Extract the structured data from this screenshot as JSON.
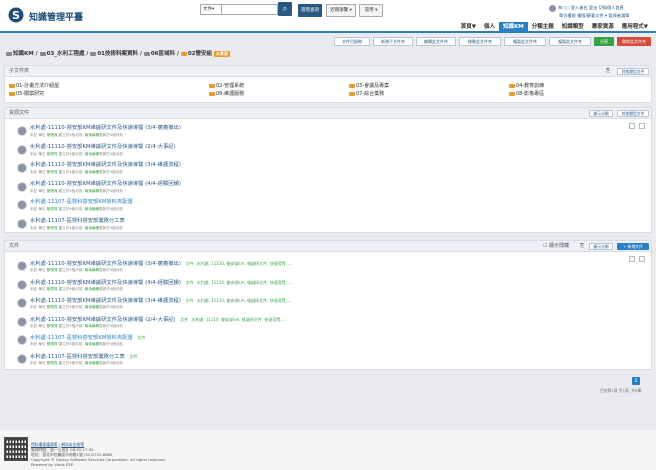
{
  "header": {
    "site_title": "知識管理平臺",
    "search_scope": "文件▾",
    "search_icon": "search-icon",
    "btn_advanced": "進階查詢",
    "btn_recent": "近期瀏覽 ▾",
    "btn_common": "常用 ▾",
    "user_line1": "林○○ 登入後台  登出  切換個人首頁",
    "user_line2": "單位權限  權限/觀看文件 ▾  管理者選單",
    "nav": [
      "首頁▼",
      "個人",
      "知識KM",
      "分類主題",
      "知識類型",
      "專家資源",
      "應用程式▼"
    ],
    "nav_active": 2
  },
  "toolbar": [
    "文件目錄樹",
    "新增子文件夾",
    "編輯此文件夾",
    "移動此文件夾",
    "複製此文件夾",
    "複製此文件夾",
    "",
    "刪除文件夾"
  ],
  "toolbar_green": "分享",
  "toolbar_red": "刪除此文件夾",
  "breadcrumb": [
    "知識KM",
    "03_水利工程處",
    "01技術科案資料",
    "06區域科",
    "02營安組"
  ],
  "breadcrumb_tag": "水資源",
  "subfolders": {
    "title": "子文件夾",
    "btn": "其他類型文件",
    "items": [
      "01-計畫方法介紹屋",
      "02-管理系統",
      "03-會議及專案",
      "04-教育訓練",
      "05-關案研究",
      "06-維護服務",
      "07-綜合業務",
      "08-影像專區"
    ]
  },
  "resources": {
    "title": "資源文件",
    "btn1": "顯示分類",
    "btn2": "其他類型文件",
    "items": [
      {
        "title": "水利處-11110-營安部KM維誠研文件及快速導覽 (3/4-廣義撤出)",
        "meta1": "未記 單位 ",
        "meta_g": "管理員",
        "meta2": " 建立於4個月前, ",
        "meta_g2": "最後編輯",
        "meta3": "更新於4個月前",
        "hl": false
      },
      {
        "title": "水利處-11110-營安部KM維誠研文件及快速導覽 (2/4-大事記)",
        "meta1": "未記 單位 ",
        "meta_g": "管理員",
        "meta2": " 建立於4個月前, ",
        "meta_g2": "最後編輯",
        "meta3": "更新於4個月前",
        "hl": false
      },
      {
        "title": "水利處-11110-營安部KM維誠研文件及快速導覽 (3/4-維護流程)",
        "meta1": "未記 單位 ",
        "meta_g": "管理員",
        "meta2": " 建立於4個月前, ",
        "meta_g2": "最後編輯",
        "meta3": "更新於4個月前",
        "hl": false
      },
      {
        "title": "水利處-11110-營安部KM維誠研文件及快速導覽 (4/4-經驗回饋)",
        "meta1": "未記 單位 ",
        "meta_g": "管理員",
        "meta2": " 建立於4個月前, ",
        "meta_g2": "最後編輯",
        "meta3": "更新於4個月前",
        "hl": false
      },
      {
        "title": "水利處-11107-區營科營安部KM資料夾配置",
        "meta1": "未記 單位 ",
        "meta_g": "管理員",
        "meta2": " 建立於4個月前, ",
        "meta_g2": "最後編輯",
        "meta3": "更新於4個月前",
        "hl": true
      },
      {
        "title": "水利處-11107-區營科營安部業務分工表",
        "meta1": "未記 單位 ",
        "meta_g": "管理員",
        "meta2": " 建立於4個月前, ",
        "meta_g2": "最後編輯",
        "meta3": "更新於4個月前",
        "hl": false
      }
    ]
  },
  "files": {
    "title": "文件",
    "checkbox_label": "顯示隱藏",
    "btn1": "顯示分類",
    "btn2": "+ 新增文件",
    "items": [
      {
        "title": "水利處-11110-營安部KM維誠研文件及快速導覽 (3/4-廣義撤出)",
        "kind": "文件",
        "tags": "水利處, 11110, 營安部km, 維誠研文件, 快速導覽, ...",
        "meta1": "未記 單位 ",
        "meta_g": "管理員",
        "meta2": " 建立於4個月前, ",
        "meta_g2": "最後編輯",
        "meta3": "更新於4個月前",
        "hl": false
      },
      {
        "title": "水利處-11110-營安部KM維誠研文件及快速導覽 (4/4-經驗回饋)",
        "kind": "文件",
        "tags": "水利處, 11110, 營安部km, 維誠研文件, 快速導覽, ...",
        "meta1": "未記 單位 ",
        "meta_g": "管理員",
        "meta2": " 建立於4個月前, ",
        "meta_g2": "最後編輯",
        "meta3": "更新於4個月前",
        "hl": false
      },
      {
        "title": "水利處-11110-營安部KM維誠研文件及快速導覽 (3/4-維護流程)",
        "kind": "文件",
        "tags": "水利處, 11110, 營安部km, 維誠研文件, 快速導覽, ...",
        "meta1": "未記 單位 ",
        "meta_g": "管理員",
        "meta2": " 建立於4個月前, ",
        "meta_g2": "最後編輯",
        "meta3": "更新於4個月前",
        "hl": false
      },
      {
        "title": "水利處-11110-營安部KM維誠研文件及快速導覽 (2/4-大事記)",
        "kind": "文件",
        "tags": "水利處, 11110, 營安部km, 維誠研文件, 快速導覽, ...",
        "meta1": "未記 單位 ",
        "meta_g": "管理員",
        "meta2": " 建立於4個月前, ",
        "meta_g2": "最後編輯",
        "meta3": "更新於4個月前",
        "hl": false
      },
      {
        "title": "水利處-11107-區營科營安部KM資料夾配置",
        "kind": "文件",
        "tags": "",
        "meta1": "未記 單位 ",
        "meta_g": "管理員",
        "meta2": " 建立於4個月前, ",
        "meta_g2": "最後編輯",
        "meta3": "更新於4個月前",
        "hl": true
      },
      {
        "title": "水利處-11107-區營科營安部業務分工表",
        "kind": "文件",
        "tags": "",
        "meta1": "未記 單位 ",
        "meta_g": "管理員",
        "meta2": " 建立於4個月前, ",
        "meta_g2": "最後編輯",
        "meta3": "更新於4個月前",
        "hl": false
      }
    ]
  },
  "pagination": {
    "current": "1",
    "summary": "目前第1頁 共1頁, 共6筆"
  },
  "footer": {
    "links": [
      "隱私權保護政策",
      "網站安全政策"
    ],
    "lines": [
      "服務時間：週一至週五 08:30-17:30",
      "地址：臺北市信義區市府路1號 (02)2720-8889",
      "Copyright © Galaxy Software Services Corporation. All rights reserved.",
      "Powered by Vitals ESP"
    ]
  }
}
